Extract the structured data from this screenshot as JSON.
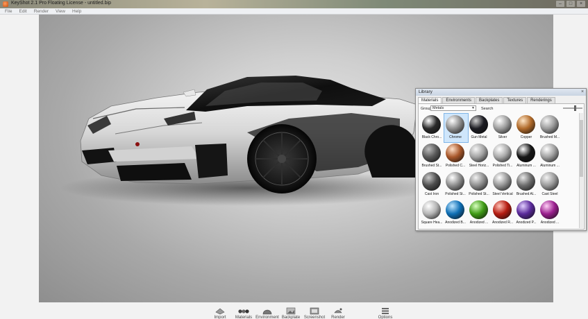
{
  "window": {
    "title": "KeyShot 2.1 Pro Floating License - untitled.bip",
    "controls": [
      "–",
      "□",
      "×"
    ]
  },
  "menu": [
    "File",
    "Edit",
    "Render",
    "View",
    "Help"
  ],
  "library": {
    "title": "Library",
    "close": "×",
    "tabs": [
      {
        "label": "Materials",
        "active": true
      },
      {
        "label": "Environments",
        "active": false
      },
      {
        "label": "Backplates",
        "active": false
      },
      {
        "label": "Textures",
        "active": false
      },
      {
        "label": "Renderings",
        "active": false
      }
    ],
    "group_label": "Group",
    "group_value": "Metals",
    "search_label": "Search",
    "materials": [
      {
        "label": "Black Chro...",
        "color": "#2a2a2a",
        "hi": "#ffffff",
        "selected": false
      },
      {
        "label": "Chrome",
        "color": "#8e8e8e",
        "hi": "#ffffff",
        "selected": true
      },
      {
        "label": "Gun Metal",
        "color": "#1c1c22",
        "hi": "#d0d0d0",
        "selected": false
      },
      {
        "label": "Silver",
        "color": "#9c9c9c",
        "hi": "#ffffff",
        "selected": false
      },
      {
        "label": "Copper",
        "color": "#b06a2a",
        "hi": "#ffe6c6",
        "selected": false
      },
      {
        "label": "Brushed M...",
        "color": "#9a9a9a",
        "hi": "#f4f4f4",
        "selected": false
      },
      {
        "label": "Brushed St...",
        "color": "#5a5a5a",
        "hi": "#bdbdbd",
        "selected": false
      },
      {
        "label": "Polished C...",
        "color": "#a8572a",
        "hi": "#ffe0c8",
        "selected": false
      },
      {
        "label": "Steel Horiz...",
        "color": "#a2a2a2",
        "hi": "#f6f6f6",
        "selected": false
      },
      {
        "label": "Polished Ti...",
        "color": "#a9a9a9",
        "hi": "#ffffff",
        "selected": false
      },
      {
        "label": "Aluminum ...",
        "color": "#161616",
        "hi": "#ffffff",
        "selected": false
      },
      {
        "label": "Aluminum ...",
        "color": "#a0a0a0",
        "hi": "#ffffff",
        "selected": false
      },
      {
        "label": "Cast Iron",
        "color": "#4e4e4e",
        "hi": "#c9c9c9",
        "selected": false
      },
      {
        "label": "Polished St...",
        "color": "#8d8d8d",
        "hi": "#ffffff",
        "selected": false
      },
      {
        "label": "Polished St...",
        "color": "#8e8e8e",
        "hi": "#f2f2f2",
        "selected": false
      },
      {
        "label": "Steel Vertical",
        "color": "#949494",
        "hi": "#ffffff",
        "selected": false
      },
      {
        "label": "Brushed Al...",
        "color": "#6c6c6c",
        "hi": "#e8e8e8",
        "selected": false
      },
      {
        "label": "Cast Steel",
        "color": "#9a9a9a",
        "hi": "#f4f4f4",
        "selected": false
      },
      {
        "label": "Square Hea...",
        "color": "#b5b5b5",
        "hi": "#ffffff",
        "selected": false
      },
      {
        "label": "Anodized B...",
        "color": "#0f6fb5",
        "hi": "#bfe6ff",
        "selected": false
      },
      {
        "label": "Anodized ...",
        "color": "#3f9b15",
        "hi": "#d8ffc0",
        "selected": false
      },
      {
        "label": "Anodized R...",
        "color": "#b51d12",
        "hi": "#ffc3b8",
        "selected": false
      },
      {
        "label": "Anodized P...",
        "color": "#5a2a9a",
        "hi": "#e2cfff",
        "selected": false
      },
      {
        "label": "Anodized ...",
        "color": "#9a1f8e",
        "hi": "#ffd0f6",
        "selected": false
      }
    ]
  },
  "toolbar": [
    {
      "label": "Import",
      "icon": "import-icon"
    },
    {
      "label": "Materials",
      "icon": "materials-icon"
    },
    {
      "label": "Environment",
      "icon": "environment-icon"
    },
    {
      "label": "Backplate",
      "icon": "backplate-icon"
    },
    {
      "label": "Screenshot",
      "icon": "screenshot-icon"
    },
    {
      "label": "Render",
      "icon": "render-icon"
    },
    {
      "label": "",
      "icon": "spacer"
    },
    {
      "label": "Options",
      "icon": "options-icon"
    }
  ]
}
